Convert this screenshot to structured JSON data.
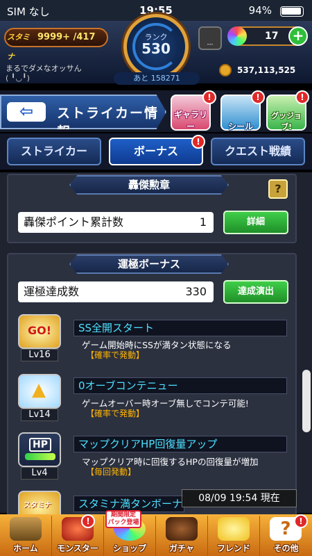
{
  "status": {
    "carrier": "SIM なし",
    "time": "19:55",
    "battery": "94%"
  },
  "header": {
    "stamina_label": "スタミナ",
    "stamina_value": "9999+ /417",
    "rank_label": "ランク",
    "rank_value": "530",
    "next_label": "あと 158271",
    "username": "まるでダメなオッサん",
    "user_sub": "( ╹◡╹)",
    "box_label": "---",
    "orb_count": "17",
    "coins": "537,113,525"
  },
  "titlebar": {
    "back_arrow": "⇦",
    "title": "ストライカー情報"
  },
  "shortcuts": [
    {
      "label": "ギャラリー",
      "color": "#d9486f"
    },
    {
      "label": "シール",
      "color": "#2f8fd0"
    },
    {
      "label": "グッジョブ!",
      "color": "#39b54a"
    }
  ],
  "tabs": [
    {
      "label": "ストライカー"
    },
    {
      "label": "ボーナス"
    },
    {
      "label": "クエスト戦績"
    }
  ],
  "badge": "!",
  "goketsu": {
    "title": "轟傑勲章",
    "help": "?",
    "row_label": "轟傑ポイント累計数",
    "row_value": "1",
    "button": "詳細"
  },
  "unkiwa": {
    "title": "運極ボーナス",
    "row_label": "運極達成数",
    "row_value": "330",
    "button": "達成演出"
  },
  "bonuses": [
    {
      "icon": "GO!",
      "level": "Lv16",
      "name": "SS全開スタート",
      "desc": "ゲーム開始時にSSが満タン状態になる",
      "trigger": "【確率で発動】"
    },
    {
      "icon": "wing",
      "level": "Lv14",
      "name": "0オーブコンテニュー",
      "desc": "ゲームオーバー時オーブ無しでコンテ可能!",
      "trigger": "【確率で発動】"
    },
    {
      "icon": "HP",
      "level": "Lv4",
      "name": "マップクリアHP回復量アップ",
      "desc": "マップクリア時に回復するHPの回復量が増加",
      "trigger": "【毎回発動】"
    },
    {
      "icon": "スタミナ",
      "level": "",
      "name": "スタミナ満タンボーナス",
      "desc": "",
      "trigger": ""
    }
  ],
  "timestamp": "08/09 19:54 現在",
  "nav": [
    {
      "label": "ホーム"
    },
    {
      "label": "モンスター"
    },
    {
      "label": "ショップ"
    },
    {
      "label": "ガチャ"
    },
    {
      "label": "フレンド"
    },
    {
      "label": "その他"
    }
  ],
  "shop_tag": "期間限定\nパック登場"
}
